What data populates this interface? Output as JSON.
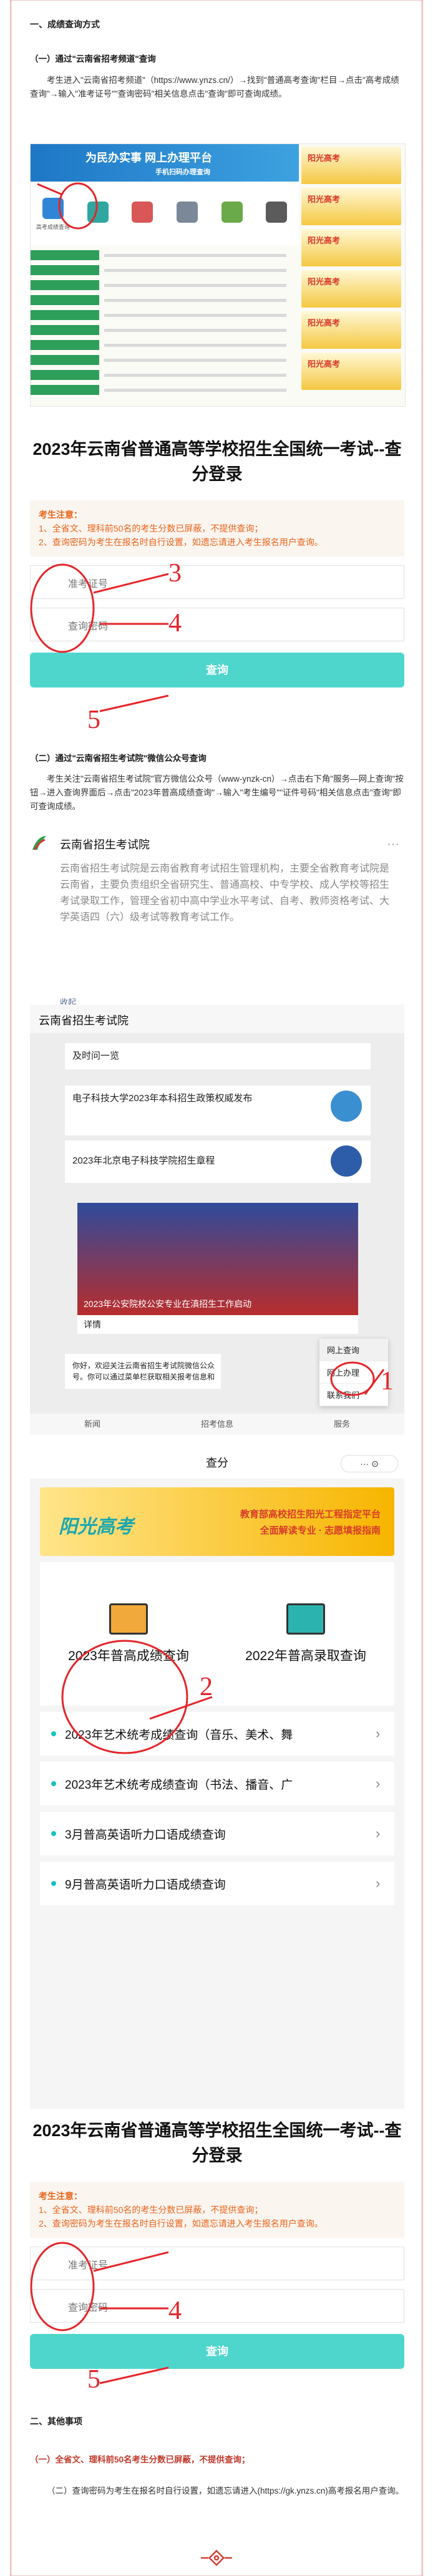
{
  "section1": {
    "heading": "一、成绩查询方式",
    "sub1": "（一）通过\"云南省招考频道\"查询",
    "para1": "考生进入\"云南省招考频道\"（https://www.ynzs.cn/）→找到\"普通高考查询\"栏目→点击\"高考成绩查询\"→输入\"准考证号\"\"查询密码\"相关信息点击\"查询\"即可查询成绩。"
  },
  "portal": {
    "banner_main": "为民办实事 网上办理平台",
    "banner_sub": "手机扫码办理查询",
    "icons": [
      "高考成绩查询",
      "",
      "",
      "",
      "",
      ""
    ],
    "side_cards": [
      "阳光高考",
      "阳光高考",
      "阳光高考",
      "阳光高考",
      "阳光高考",
      "阳光高考"
    ]
  },
  "form": {
    "title": "2023年云南省普通高等学校招生全国统一考试--查分登录",
    "notice_title": "考生注意：",
    "notice_1": "1、全省文、理科前50名的考生分数已屏蔽，不提供查询；",
    "notice_2": "2、查询密码为考生在报名时自行设置，如遗忘请进入考生报名用户查询。",
    "field_1": "准考证号",
    "field_2": "查询密码",
    "button": "查询"
  },
  "section2": {
    "sub2": "（二）通过\"云南省招生考试院\"微信公众号查询",
    "para2": "考生关注\"云南省招生考试院\"官方微信公众号（www-ynzk-cn）→点击右下角\"服务—网上查询\"按钮→进入查询界面后→点击\"2023年普高成绩查询\"→输入\"考生编号\"\"证件号码\"相关信息点击\"查询\"即可查询成绩。"
  },
  "wechat": {
    "name": "云南省招生考试院",
    "more": "···",
    "desc": "云南省招生考试院是云南省教育考试招生管理机构，主要全省教育考试院是云南省，主要负责组织全省研究生、普通高校、中专学校、成人学校等招生考试录取工作，管理全省初中高中学业水平考试、自考、教师资格考试、大学英语四（六）级考试等教育考试工作。",
    "fold": "收起"
  },
  "chat": {
    "title": "云南省招生考试院",
    "msg1": "及时问一览",
    "msg2": "电子科技大学2023年本科招生政策权威发布",
    "msg3": "2023年北京电子科技学院招生章程",
    "hero_caption": "2023年公安院校公安专业在滇招生工作启动",
    "detail": "详情",
    "menu": [
      "网上查询",
      "网上办理",
      "联系我们"
    ],
    "welcome": "你好，欢迎关注云南省招生考试院微信公众号。你可以通过菜单栏获取相关报考信息和",
    "tabs": [
      "新闻",
      "招考信息",
      "服务"
    ]
  },
  "app": {
    "bar_title": "查分",
    "caps": "··· ⊙",
    "sun_brand": "阳光高考",
    "sun_line1": "教育部高校招生阳光工程指定平台",
    "sun_line2": "全面解读专业 · 志愿填报指南",
    "cell_1": "2023年普高成绩查询",
    "cell_2": "2022年普高录取查询",
    "items": [
      "2023年艺术统考成绩查询（音乐、美术、舞",
      "2023年艺术统考成绩查询（书法、播音、广",
      "3月普高英语听力口语成绩查询",
      "9月普高英语听力口语成绩查询"
    ]
  },
  "form2": {
    "title": "2023年云南省普通高等学校招生全国统一考试--查分登录",
    "notice_title": "考生注意：",
    "notice_1": "1、全省文、理科前50名的考生分数已屏蔽，不提供查询；",
    "notice_2": "2、查询密码为考生在报名时自行设置，如遗忘请进入考生报名用户查询。",
    "field_1": "准考证号",
    "field_2": "查询密码",
    "button": "查询"
  },
  "section3": {
    "heading": "二、其他事项",
    "item1": "（一）全省文、理科前50名考生分数已屏蔽，不提供查询；",
    "item2": "（二）查询密码为考生在报名时自行设置，如遗忘请进入(https://gk.ynzs.cn)高考报名用户查询。"
  },
  "annotations": [
    "3",
    "4",
    "5",
    "1",
    "2",
    "4",
    "5"
  ]
}
